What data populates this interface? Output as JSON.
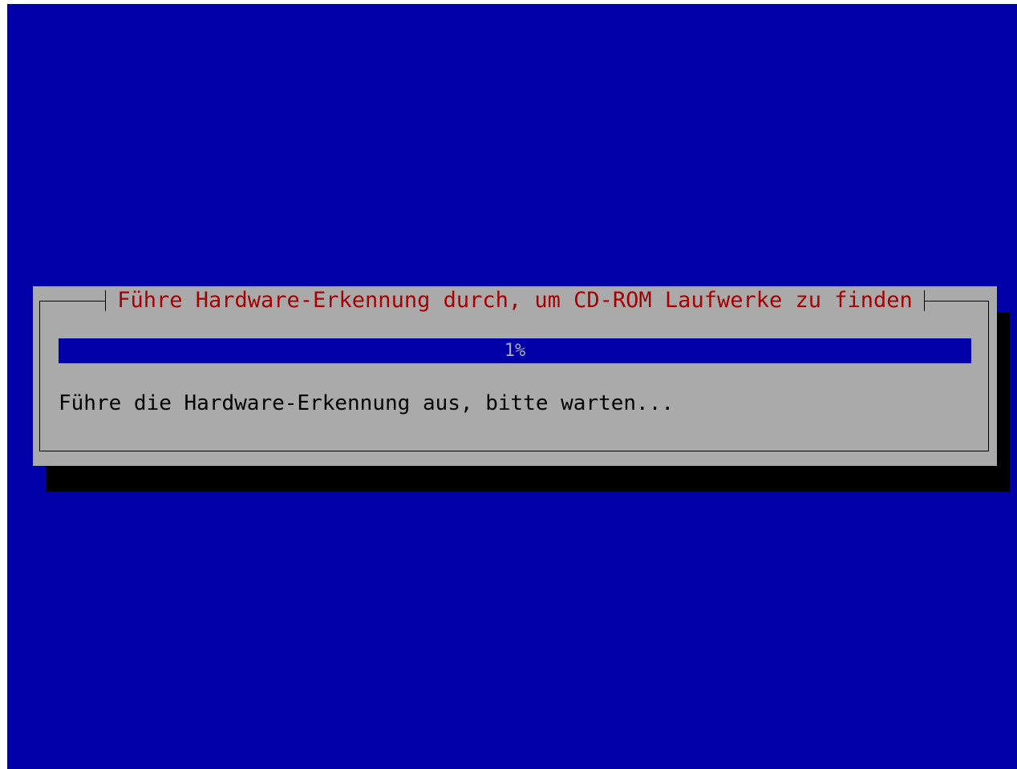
{
  "dialog": {
    "title": "Führe Hardware-Erkennung durch, um CD-ROM Laufwerke zu finden",
    "progress_percent": 1,
    "progress_label": "1%",
    "status_message": "Führe die Hardware-Erkennung aus, bitte warten..."
  },
  "colors": {
    "background": "#0000a8",
    "dialog": "#aaaaaa",
    "title": "#a80000",
    "shadow": "#000000"
  }
}
